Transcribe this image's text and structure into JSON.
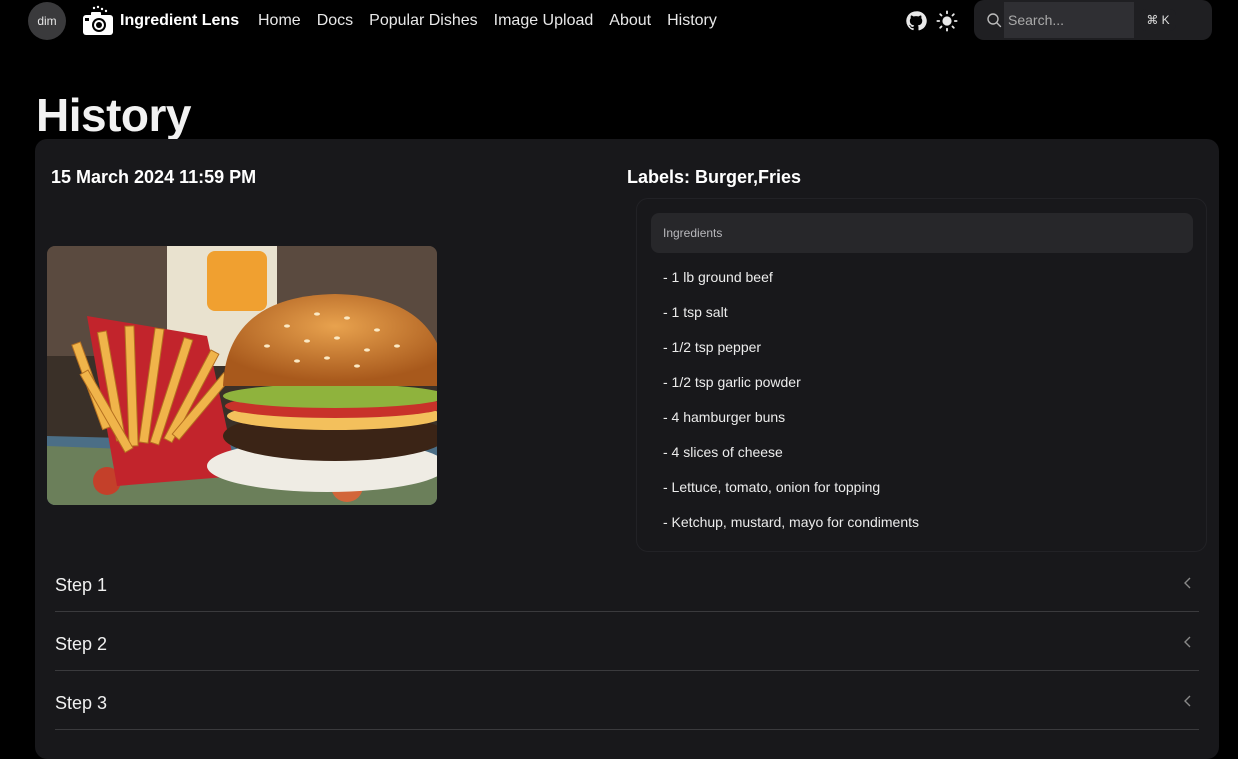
{
  "nav": {
    "avatar_text": "dim",
    "brand": "Ingredient Lens",
    "links": [
      "Home",
      "Docs",
      "Popular Dishes",
      "Image Upload",
      "About",
      "History"
    ],
    "icons": [
      "github-icon",
      "sun-icon",
      "search-icon"
    ]
  },
  "search": {
    "placeholder": "Search...",
    "shortcut": "⌘ K"
  },
  "page": {
    "title": "History"
  },
  "entry": {
    "date": "15 March 2024 11:59 PM",
    "labels": "Labels: Burger,Fries",
    "ingredients_header": "Ingredients",
    "ingredients": [
      "- 1 lb ground beef",
      "- 1 tsp salt",
      "- 1/2 tsp pepper",
      "- 1/2 tsp garlic powder",
      "- 4 hamburger buns",
      "- 4 slices of cheese",
      "- Lettuce, tomato, onion for topping",
      "- Ketchup, mustard, mayo for condiments"
    ],
    "steps": [
      "Step 1",
      "Step 2",
      "Step 3"
    ]
  }
}
